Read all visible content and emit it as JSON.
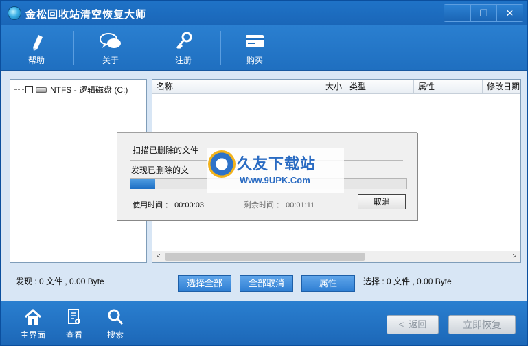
{
  "window": {
    "title": "金松回收站清空恢复大师",
    "minimize": "—",
    "maximize": "☐",
    "close": "✕"
  },
  "toolbar": {
    "items": [
      {
        "label": "帮助",
        "icon": "pen-help-icon"
      },
      {
        "label": "关于",
        "icon": "chat-bubbles-icon"
      },
      {
        "label": "注册",
        "icon": "key-icon"
      },
      {
        "label": "购买",
        "icon": "card-icon"
      }
    ]
  },
  "tree": {
    "drive_label": "NTFS - 逻辑磁盘 (C:)"
  },
  "file_list": {
    "columns": [
      "名称",
      "大小",
      "类型",
      "属性",
      "修改日期"
    ],
    "rows": []
  },
  "status": {
    "found": "发现 : 0 文件 , 0.00 Byte",
    "selected": "选择 : 0 文件 , 0.00 Byte"
  },
  "actions": {
    "select_all": "选择全部",
    "deselect_all": "全部取消",
    "properties": "属性"
  },
  "bottom": {
    "nav": [
      {
        "label": "主界面",
        "icon": "home-icon"
      },
      {
        "label": "查看",
        "icon": "document-view-icon"
      },
      {
        "label": "搜索",
        "icon": "search-icon"
      }
    ],
    "back": "返回",
    "restore": "立即恢复"
  },
  "dialog": {
    "scan_text": "扫描已删除的文件",
    "found_text": "发现已删除的文",
    "progress": 0.09,
    "elapsed_label": "使用时间 ：",
    "elapsed_value": "00:00:03",
    "remaining_label": "剩余时间 ：",
    "remaining_value": "00:01:11",
    "cancel": "取消"
  },
  "watermark": {
    "brand": "久友下载站",
    "url": "Www.9UPK.Com"
  },
  "colors": {
    "chrome_blue": "#1f6fc0",
    "panel_bg": "#d8e6f5",
    "progress_fill": "#1e6fc4"
  }
}
